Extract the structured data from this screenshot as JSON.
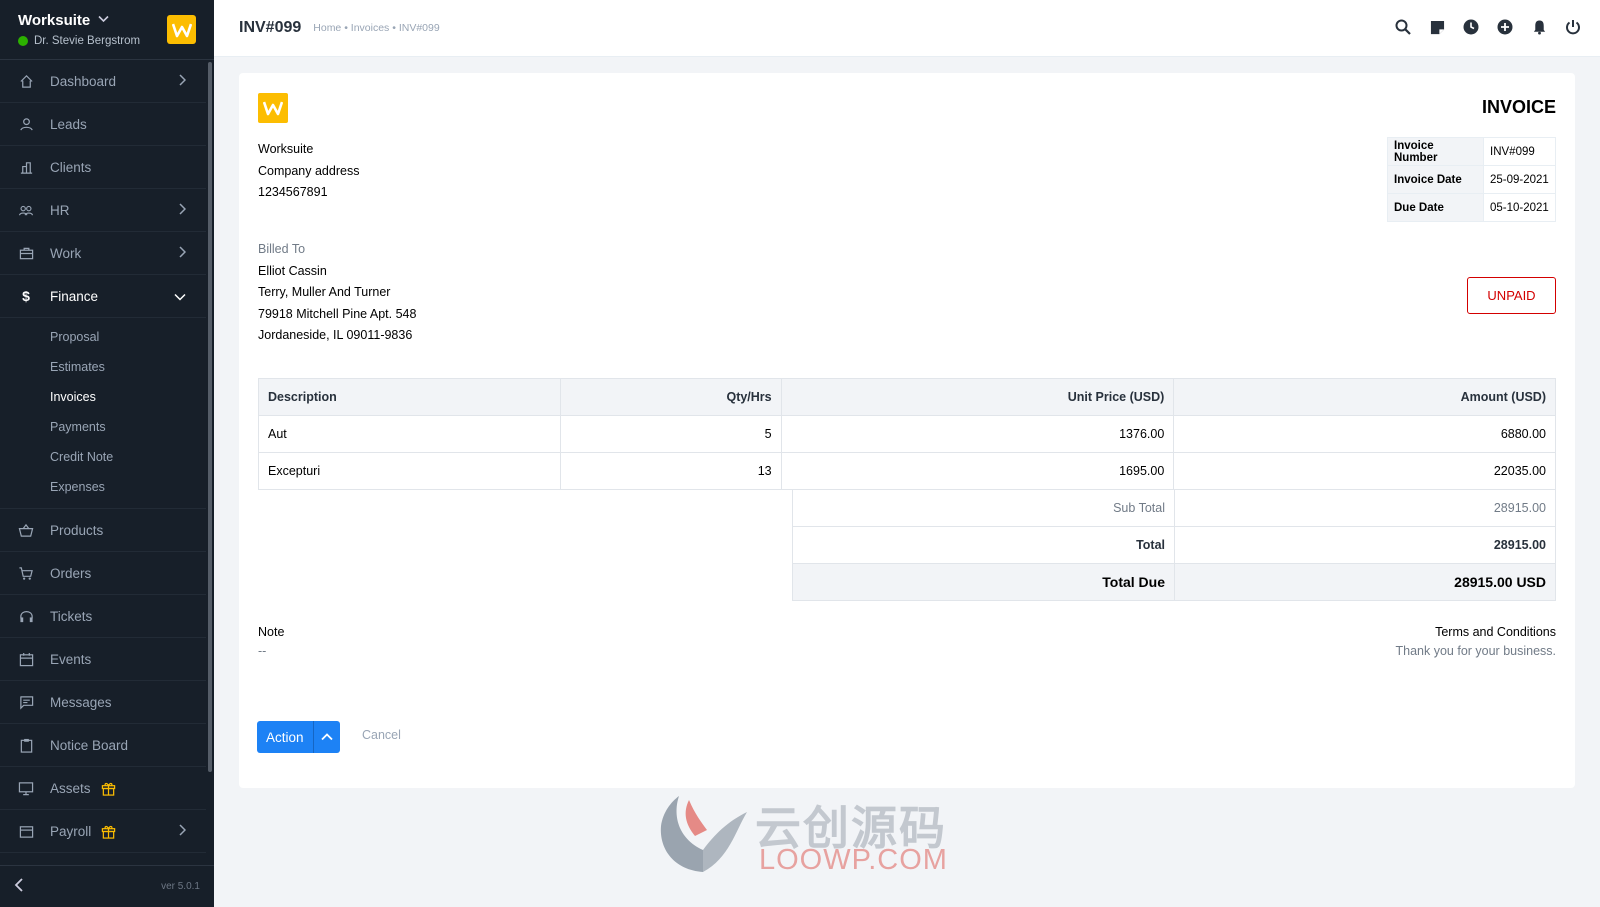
{
  "sidebar": {
    "app_name": "Worksuite",
    "user_name": "Dr. Stevie Bergstrom",
    "logo_letter": "W",
    "items": [
      {
        "label": "Dashboard",
        "icon": "house-icon"
      },
      {
        "label": "Leads",
        "icon": "person-icon"
      },
      {
        "label": "Clients",
        "icon": "building-icon"
      },
      {
        "label": "HR",
        "icon": "people-icon"
      },
      {
        "label": "Work",
        "icon": "briefcase-icon"
      },
      {
        "label": "Finance",
        "icon": "dollar-icon"
      },
      {
        "label": "Products",
        "icon": "basket-icon"
      },
      {
        "label": "Orders",
        "icon": "cart-icon"
      },
      {
        "label": "Tickets",
        "icon": "headset-icon"
      },
      {
        "label": "Events",
        "icon": "calendar-icon"
      },
      {
        "label": "Messages",
        "icon": "chat-icon"
      },
      {
        "label": "Notice Board",
        "icon": "clipboard-icon"
      },
      {
        "label": "Assets",
        "icon": "monitor-icon"
      },
      {
        "label": "Payroll",
        "icon": "wallet-icon"
      }
    ],
    "finance_sub": [
      "Proposal",
      "Estimates",
      "Invoices",
      "Payments",
      "Credit Note",
      "Expenses"
    ],
    "current_sub": "Invoices",
    "version": "ver 5.0.1"
  },
  "topbar": {
    "title": "INV#099",
    "breadcrumb": "Home • Invoices • INV#099"
  },
  "invoice": {
    "logo_letter": "W",
    "heading": "INVOICE",
    "company": {
      "name": "Worksuite",
      "address": "Company address",
      "phone": "1234567891"
    },
    "meta": [
      {
        "label": "Invoice Number",
        "value": "INV#099"
      },
      {
        "label": "Invoice Date",
        "value": "25-09-2021"
      },
      {
        "label": "Due Date",
        "value": "05-10-2021"
      }
    ],
    "billed_to": {
      "label": "Billed To",
      "name": "Elliot Cassin",
      "company": "Terry, Muller And Turner",
      "street": "79918 Mitchell Pine Apt. 548",
      "city": "Jordaneside, IL 09011-9836"
    },
    "status": "UNPAID",
    "columns": [
      "Description",
      "Qty/Hrs",
      "Unit Price (USD)",
      "Amount (USD)"
    ],
    "rows": [
      [
        "Aut",
        "5",
        "1376.00",
        "6880.00"
      ],
      [
        "Excepturi",
        "13",
        "1695.00",
        "22035.00"
      ]
    ],
    "subtotal_label": "Sub Total",
    "subtotal": "28915.00",
    "total_label": "Total",
    "total": "28915.00",
    "total_due_label": "Total Due",
    "total_due": "28915.00 USD",
    "note_label": "Note",
    "note_value": "--",
    "terms_label": "Terms and Conditions",
    "terms_value": "Thank you for your business.",
    "action_label": "Action",
    "cancel_label": "Cancel"
  },
  "watermark": {
    "cn": "云创源码",
    "en": "LOOWP.COM"
  },
  "colors": {
    "accent": "#1d82f5",
    "brand": "#fcbd01",
    "sidebar_bg": "#171f29",
    "unpaid": "#d30000",
    "online": "#2cb100"
  }
}
